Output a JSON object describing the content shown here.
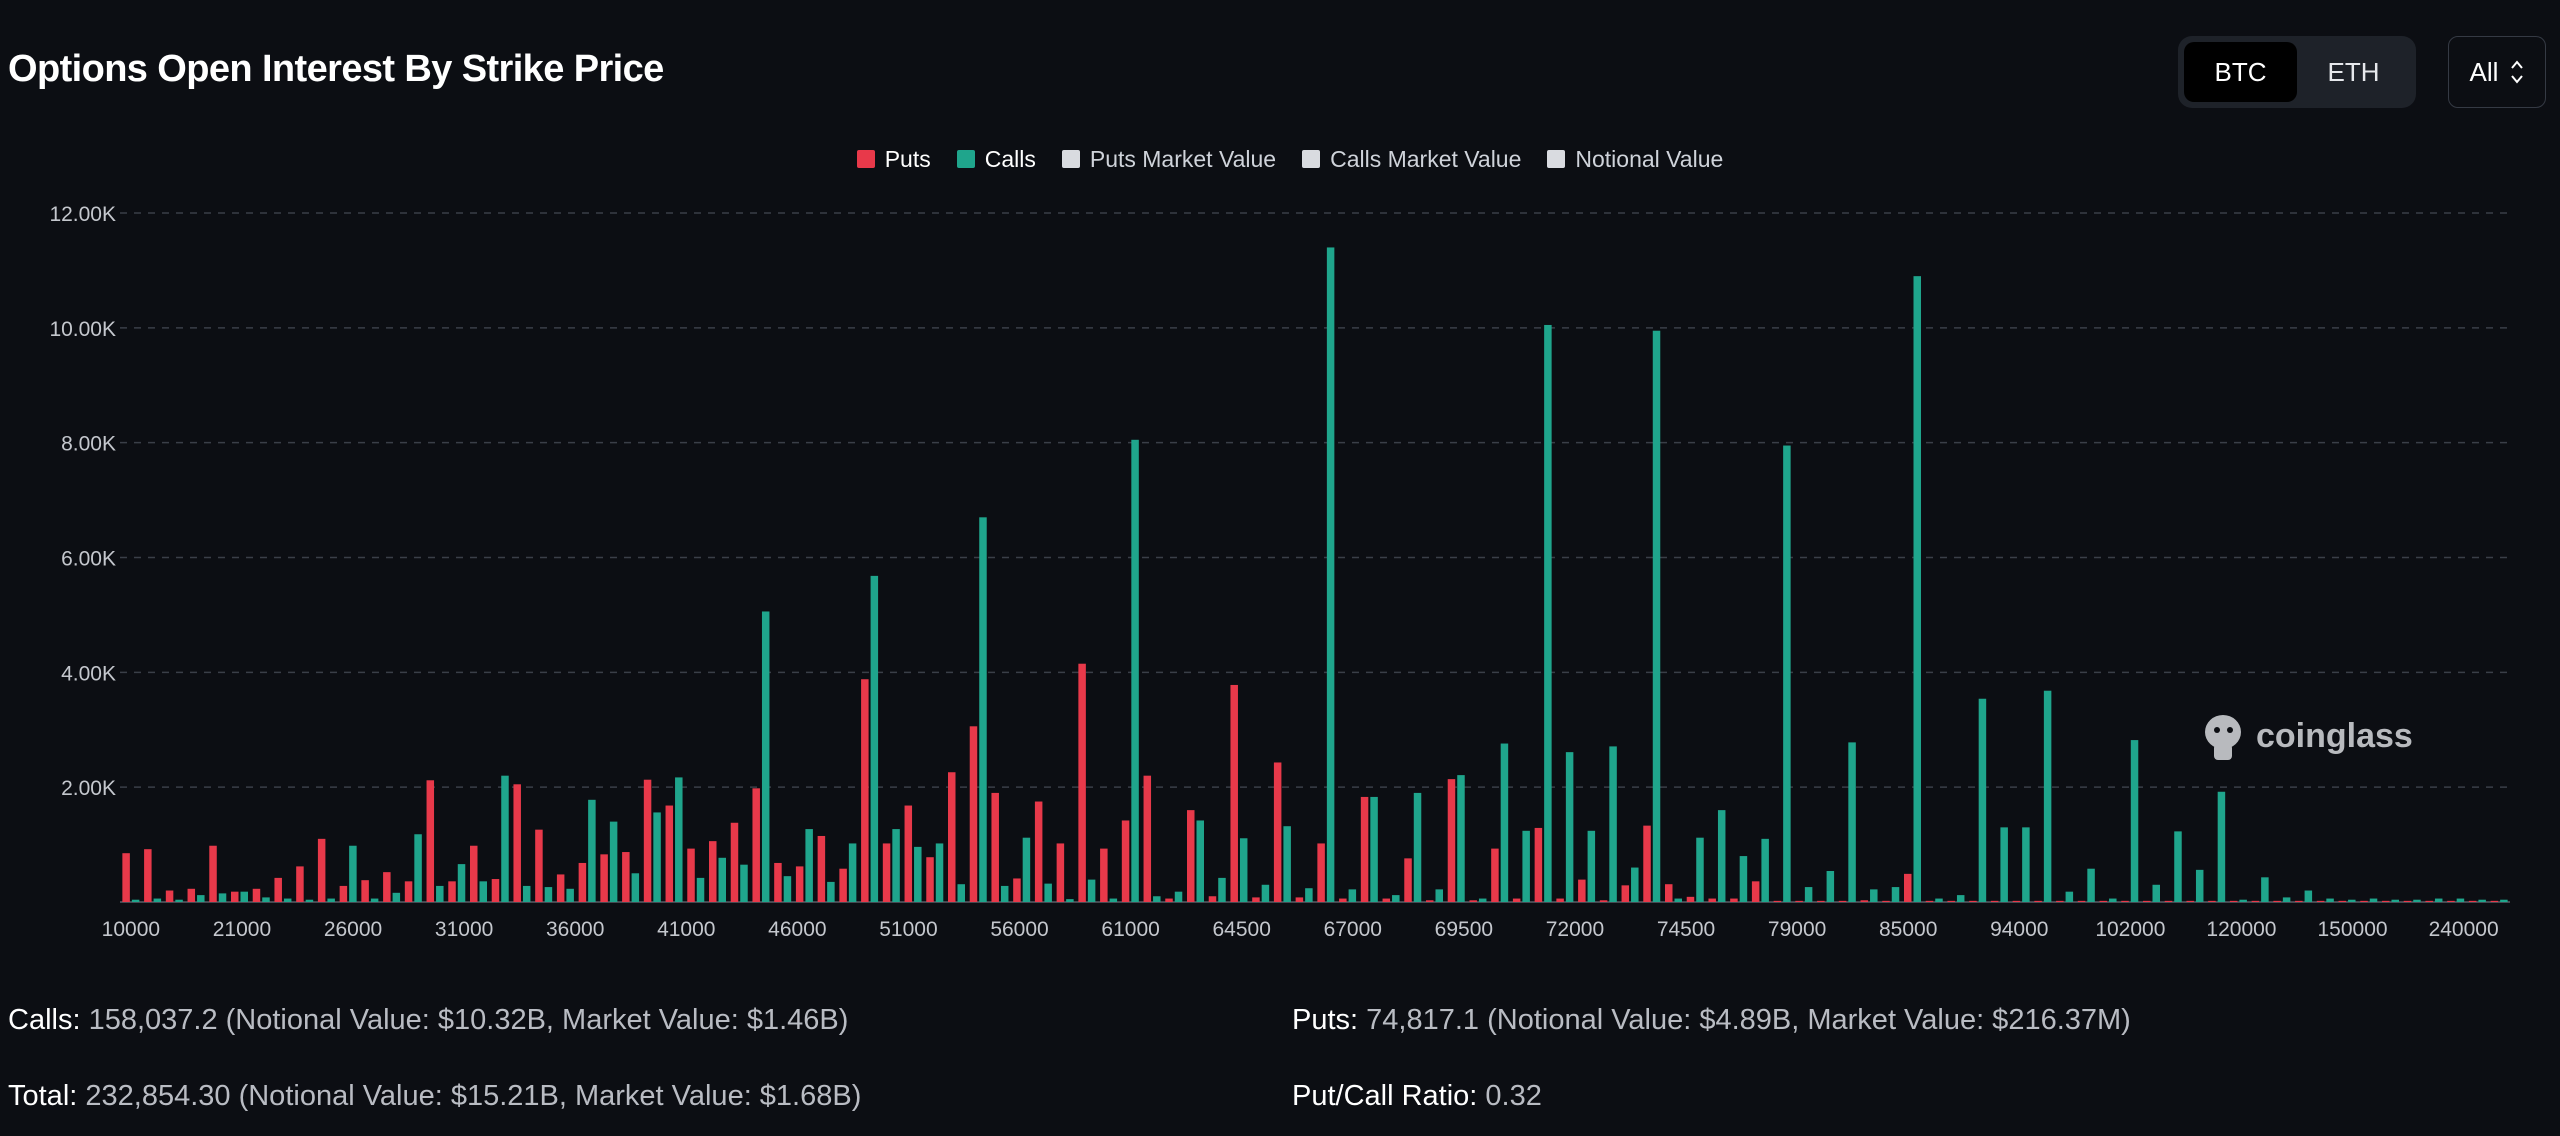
{
  "title": "Options Open Interest By Strike Price",
  "asset_toggle": {
    "options": [
      "BTC",
      "ETH"
    ],
    "selected": "BTC"
  },
  "range_select": {
    "value": "All"
  },
  "legend": {
    "puts": "Puts",
    "calls": "Calls",
    "puts_mv": "Puts Market Value",
    "calls_mv": "Calls Market Value",
    "notional": "Notional Value"
  },
  "colors": {
    "puts": "#e8394a",
    "calls": "#1fa58c",
    "muted": "#d9dbe0",
    "grid": "#3a3f48",
    "tick": "#c4c7cd",
    "background": "#0c0e13"
  },
  "watermark": "coinglass",
  "chart_data": {
    "type": "bar",
    "title": "Options Open Interest By Strike Price",
    "xlabel": "",
    "ylabel": "",
    "ylim": [
      0,
      12000
    ],
    "yticks": [
      2000,
      4000,
      6000,
      8000,
      10000,
      12000
    ],
    "ytick_labels": [
      "2.00K",
      "4.00K",
      "6.00K",
      "8.00K",
      "10.00K",
      "12.00K"
    ],
    "tick_labels": [
      "10000",
      "21000",
      "26000",
      "31000",
      "36000",
      "41000",
      "46000",
      "51000",
      "56000",
      "61000",
      "64500",
      "67000",
      "69500",
      "72000",
      "74500",
      "79000",
      "85000",
      "94000",
      "102000",
      "120000",
      "150000",
      "240000"
    ],
    "grid": true,
    "legend_position": "top-center",
    "num_strikes": 110,
    "series": [
      {
        "name": "Puts",
        "values": [
          850,
          920,
          200,
          230,
          980,
          180,
          230,
          420,
          620,
          1100,
          280,
          380,
          520,
          360,
          2120,
          360,
          980,
          400,
          2050,
          1260,
          480,
          680,
          830,
          870,
          2130,
          1680,
          930,
          1060,
          1380,
          1980,
          680,
          620,
          1150,
          580,
          3880,
          1020,
          1680,
          780,
          2260,
          3060,
          1900,
          410,
          1750,
          1020,
          4150,
          930,
          1420,
          2200,
          60,
          1600,
          100,
          3780,
          80,
          2430,
          80,
          1020,
          60,
          1830,
          60,
          760,
          30,
          2140,
          30,
          930,
          60,
          1290,
          60,
          390,
          30,
          290,
          1330,
          310,
          90,
          60,
          60,
          360,
          20,
          20,
          20,
          20,
          30,
          20,
          490,
          20,
          20,
          20,
          20,
          20,
          20,
          20,
          20,
          20,
          20,
          20,
          20,
          20,
          20,
          20,
          20,
          20,
          20,
          20,
          20,
          20,
          20,
          20,
          20,
          20,
          20,
          20
        ]
      },
      {
        "name": "Calls",
        "values": [
          40,
          60,
          40,
          120,
          150,
          180,
          80,
          60,
          40,
          60,
          980,
          60,
          160,
          1180,
          280,
          660,
          360,
          2200,
          280,
          260,
          230,
          1780,
          1400,
          500,
          1560,
          2170,
          420,
          770,
          650,
          5060,
          450,
          1270,
          350,
          1020,
          5680,
          1270,
          960,
          1020,
          310,
          6700,
          280,
          1120,
          320,
          50,
          390,
          60,
          8050,
          100,
          180,
          1420,
          420,
          1110,
          300,
          1320,
          240,
          11400,
          220,
          1830,
          120,
          1900,
          220,
          2210,
          60,
          2760,
          1240,
          10050,
          2610,
          1240,
          2710,
          600,
          9950,
          60,
          1120,
          1600,
          800,
          1100,
          7950,
          260,
          540,
          2780,
          220,
          260,
          10900,
          60,
          120,
          3540,
          1300,
          1300,
          3680,
          180,
          580,
          60,
          2820,
          300,
          1230,
          560,
          1920,
          40,
          430,
          80,
          200,
          60,
          40,
          60,
          40,
          40,
          60,
          60,
          40,
          40
        ]
      }
    ]
  },
  "footer": {
    "calls_label": "Calls:",
    "calls_text": " 158,037.2 (Notional Value: $10.32B, Market Value: $1.46B)",
    "puts_label": "Puts:",
    "puts_text": " 74,817.1 (Notional Value: $4.89B, Market Value: $216.37M)",
    "total_label": "Total:",
    "total_text": " 232,854.30 (Notional Value: $15.21B, Market Value: $1.68B)",
    "ratio_label": "Put/Call Ratio:",
    "ratio_text": " 0.32"
  }
}
